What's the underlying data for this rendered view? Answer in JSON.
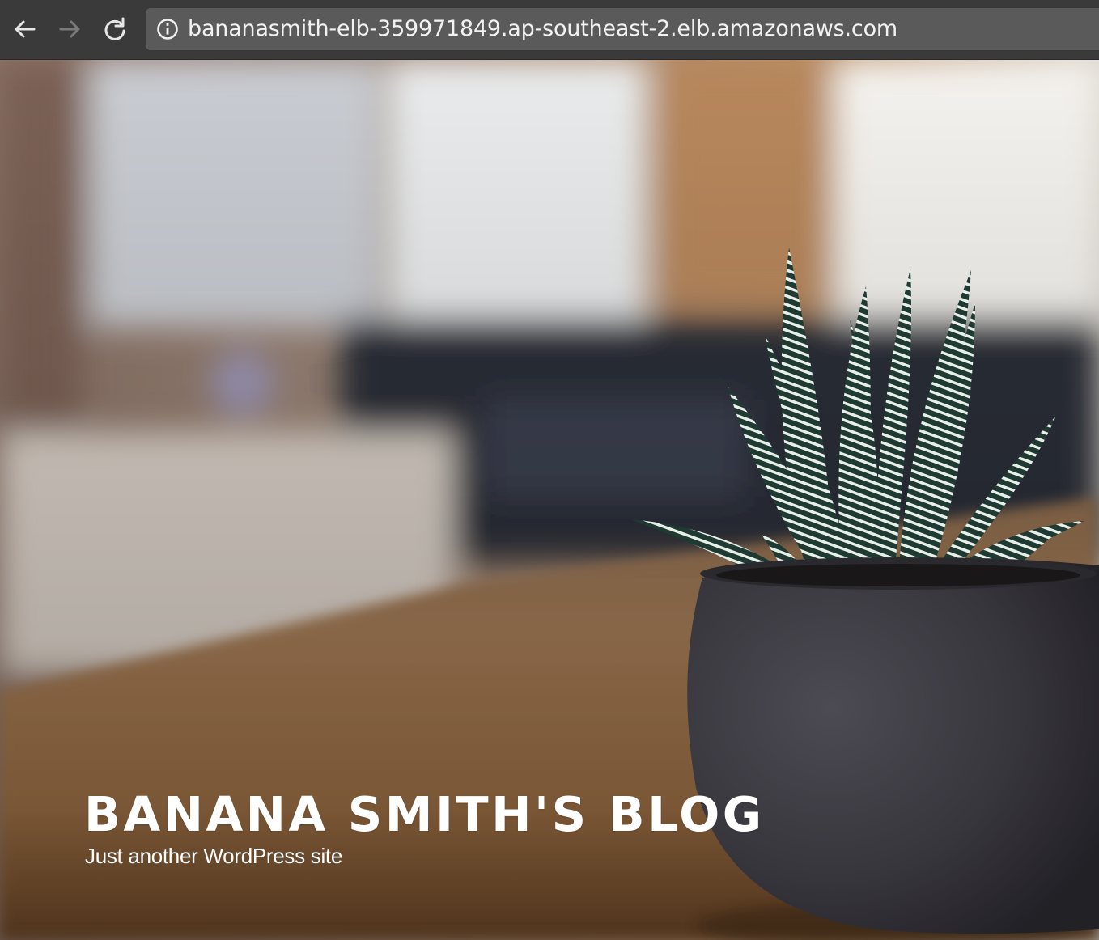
{
  "browser": {
    "url": "bananasmith-elb-359971849.ap-southeast-2.elb.amazonaws.com",
    "icons": {
      "back": "arrow-left-icon",
      "forward": "arrow-right-icon",
      "reload": "reload-icon",
      "site_info": "info-icon"
    },
    "forward_enabled": false
  },
  "site": {
    "title": "BANANA SMITH'S BLOG",
    "tagline": "Just another WordPress site"
  },
  "hero_image": {
    "subject": "potted-succulent-icon"
  },
  "colors": {
    "toolbar": "#3a3a3a",
    "omnibox": "#5a5a5a",
    "title_text": "#ffffff"
  }
}
